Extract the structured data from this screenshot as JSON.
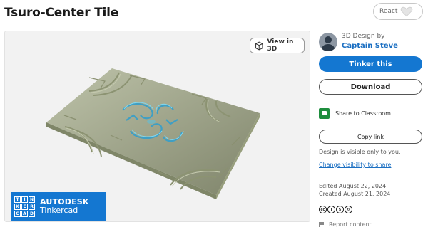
{
  "page": {
    "title": "Tsuro-Center Tile"
  },
  "react": {
    "label": "React",
    "icon": "heart-icon"
  },
  "viewer": {
    "view3d_label": "View in 3D",
    "view3d_icon": "cube-icon",
    "brand": {
      "grid_letters": [
        "T",
        "I",
        "N",
        "K",
        "E",
        "R",
        "C",
        "A",
        "D"
      ],
      "line1": "AUTODESK",
      "line2": "Tinkercad",
      "color": "#1477d1"
    },
    "model_colors": {
      "plate": "#a9b08e",
      "emblem": "#5bc0de"
    }
  },
  "sidebar": {
    "design_by": "3D Design by",
    "author": "Captain Steve",
    "tinker_label": "Tinker this",
    "download_label": "Download",
    "share_classroom": "Share to Classroom",
    "copy_link": "Copy link",
    "visibility_note": "Design is visible only to you.",
    "change_visibility": "Change visibility to share",
    "edited": "Edited August 22, 2024",
    "created": "Created August 21, 2024",
    "license_icons": [
      "cc-icon",
      "by-icon",
      "nc-icon",
      "sa-icon"
    ],
    "report": "Report content"
  },
  "colors": {
    "accent": "#1477d1",
    "link": "#1b6fc2"
  }
}
